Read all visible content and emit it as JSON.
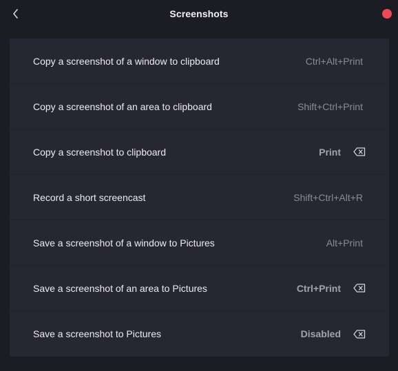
{
  "header": {
    "title": "Screenshots",
    "back_icon": "chevron-left-icon",
    "close_color": "#ec4a55"
  },
  "shortcuts": [
    {
      "label": "Copy a screenshot of a window to clipboard",
      "accel": "Ctrl+Alt+Print",
      "custom": false
    },
    {
      "label": "Copy a screenshot of an area to clipboard",
      "accel": "Shift+Ctrl+Print",
      "custom": false
    },
    {
      "label": "Copy a screenshot to clipboard",
      "accel": "Print",
      "custom": true
    },
    {
      "label": "Record a short screencast",
      "accel": "Shift+Ctrl+Alt+R",
      "custom": false
    },
    {
      "label": "Save a screenshot of a window to Pictures",
      "accel": "Alt+Print",
      "custom": false
    },
    {
      "label": "Save a screenshot of an area to Pictures",
      "accel": "Ctrl+Print",
      "custom": true
    },
    {
      "label": "Save a screenshot to Pictures",
      "accel": "Disabled",
      "custom": true
    }
  ],
  "colors": {
    "background": "#1b1c24",
    "panel": "#262732",
    "text": "#ececf0",
    "muted": "#8a8b96"
  }
}
